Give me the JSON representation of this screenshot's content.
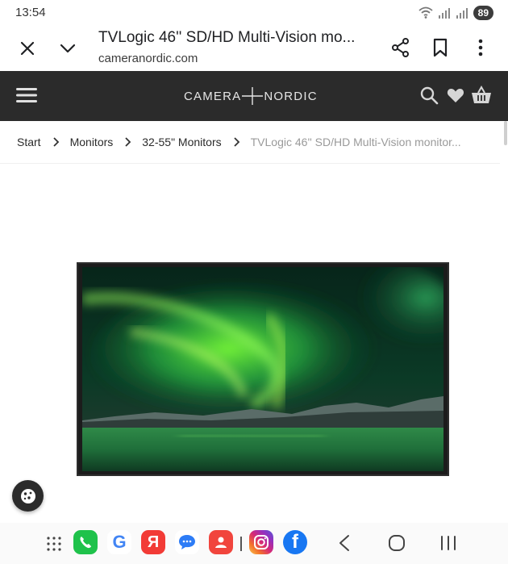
{
  "status_bar": {
    "time": "13:54",
    "battery": "89"
  },
  "custom_tab": {
    "title": "TVLogic 46'' SD/HD Multi-Vision mo...",
    "url": "cameranordic.com"
  },
  "site_header": {
    "logo_left": "CAMERA",
    "logo_right": "NORDIC"
  },
  "breadcrumb": {
    "items": [
      "Start",
      "Monitors",
      "32-55\" Monitors"
    ],
    "current": "TVLogic 46'' SD/HD Multi-Vision monitor..."
  },
  "nav_bar": {
    "apps": [
      {
        "name": "phone-app",
        "bg": "#1fc24b"
      },
      {
        "name": "google-app",
        "label": "G"
      },
      {
        "name": "yandex-app",
        "label": "Я",
        "bg": "#f23b36"
      },
      {
        "name": "messages-app",
        "bg": "#2d7cf6"
      },
      {
        "name": "contacts-app",
        "bg": "#f1453d"
      },
      {
        "name": "instagram-app"
      },
      {
        "name": "facebook-app",
        "label": "f",
        "bg": "#1877f2"
      }
    ]
  },
  "colors": {
    "header_bg": "#2b2b2b",
    "accent": "#1fc24b"
  }
}
